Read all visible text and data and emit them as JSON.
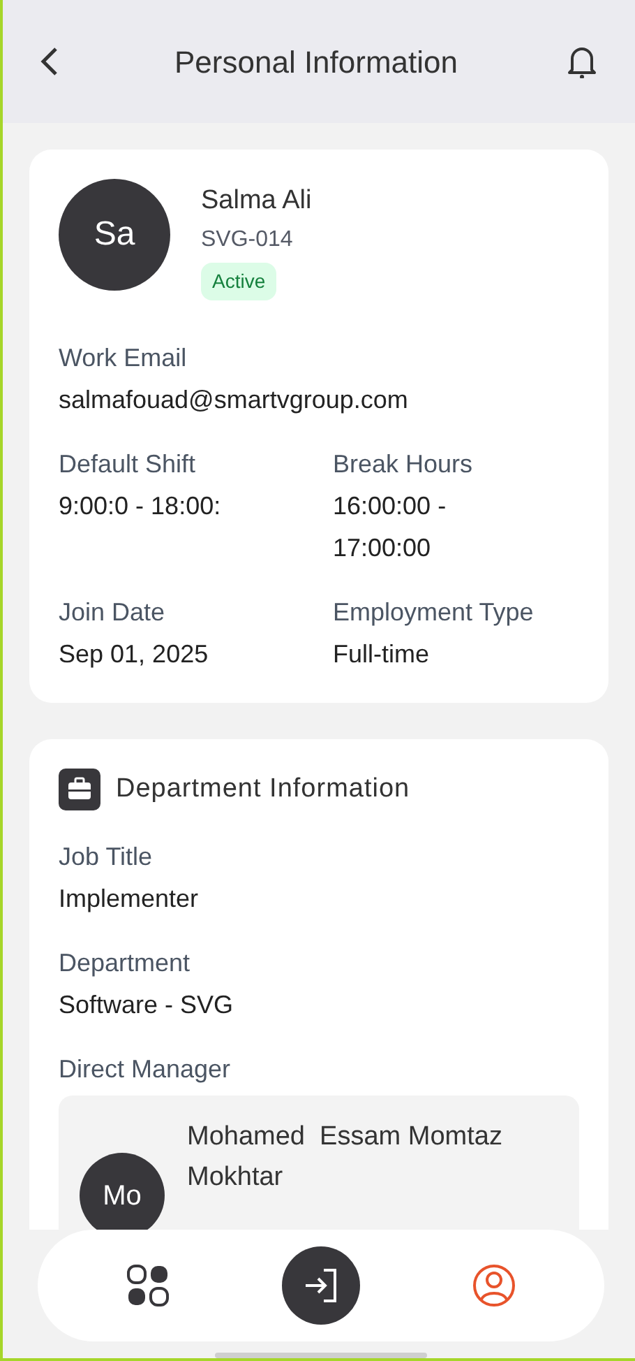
{
  "header": {
    "title": "Personal Information"
  },
  "profile": {
    "initials": "Sa",
    "name": "Salma Ali",
    "code": "SVG-014",
    "status": {
      "label": "Active",
      "kind": "active"
    },
    "email": {
      "label": "Work Email",
      "value": "salmafouad@smartvgroup.com"
    },
    "pairs": [
      [
        {
          "label": "Default Shift",
          "value": "9:00:0 - 18:00:"
        },
        {
          "label": "Break Hours",
          "value": "16:00:00 - 17:00:00"
        }
      ],
      [
        {
          "label": "Join Date",
          "value": "Sep 01, 2025"
        },
        {
          "label": "Employment Type",
          "value": "Full-time"
        }
      ]
    ]
  },
  "department": {
    "title": "Department Information",
    "fields": [
      {
        "label": "Job Title",
        "value": "Implementer"
      },
      {
        "label": "Department",
        "value": "Software - SVG"
      }
    ],
    "manager": {
      "label": "Direct Manager",
      "initials": "Mo",
      "name": "Mohamed  Essam Momtaz Mokhtar"
    }
  },
  "nav": [
    {
      "kind": "grid",
      "selected": false
    },
    {
      "kind": "checkin",
      "selected": false
    },
    {
      "kind": "profile",
      "selected": true
    }
  ]
}
